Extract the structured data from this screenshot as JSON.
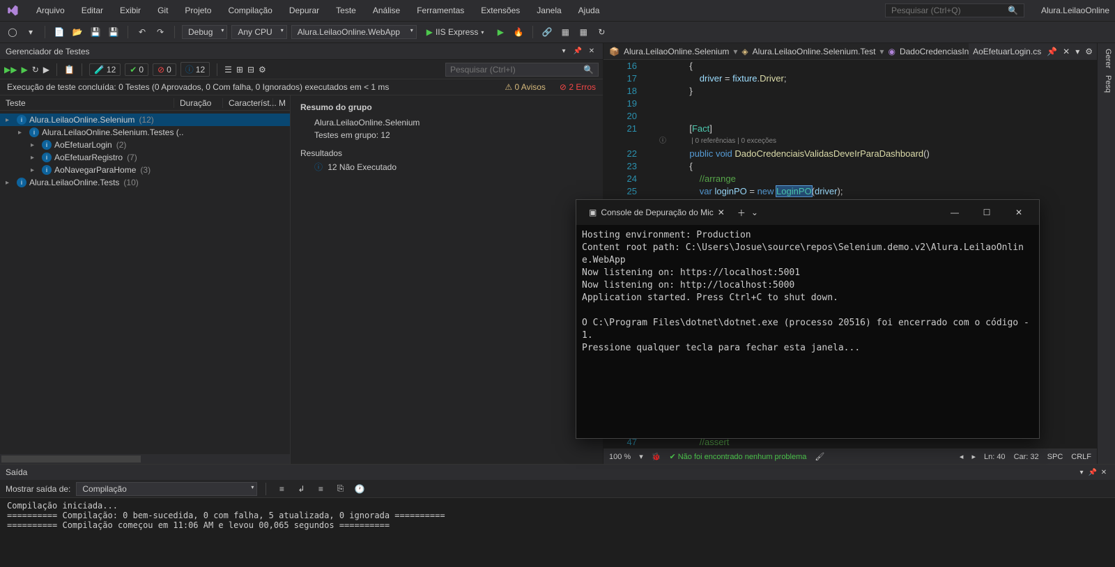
{
  "menubar": {
    "items": [
      "Arquivo",
      "Editar",
      "Exibir",
      "Git",
      "Projeto",
      "Compilação",
      "Depurar",
      "Teste",
      "Análise",
      "Ferramentas",
      "Extensões",
      "Janela",
      "Ajuda"
    ],
    "search_placeholder": "Pesquisar (Ctrl+Q)",
    "solution": "Alura.LeilaoOnline"
  },
  "toolbar": {
    "config": "Debug",
    "platform": "Any CPU",
    "startup": "Alura.LeilaoOnline.WebApp",
    "run_label": "IIS Express"
  },
  "test_explorer": {
    "title": "Gerenciador de Testes",
    "counters": {
      "flask": "12",
      "pass": "0",
      "fail": "0",
      "skip": "12"
    },
    "search_placeholder": "Pesquisar (Ctrl+I)",
    "status_line": "Execução de teste concluída: 0 Testes (0 Aprovados, 0 Com falha, 0 Ignorados) executados em < 1 ms",
    "warnings": "0 Avisos",
    "errors": "2 Erros",
    "columns": {
      "test": "Teste",
      "duration": "Duração",
      "traits": "Característ...",
      "m": "M"
    },
    "tree": [
      {
        "indent": 0,
        "caret": "▸",
        "label": "Alura.LeilaoOnline.Selenium",
        "count": "(12)",
        "selected": true
      },
      {
        "indent": 1,
        "caret": "▸",
        "label": "Alura.LeilaoOnline.Selenium.Testes (..",
        "count": ""
      },
      {
        "indent": 2,
        "caret": "▸",
        "label": "AoEfetuarLogin",
        "count": "(2)"
      },
      {
        "indent": 2,
        "caret": "▸",
        "label": "AoEfetuarRegistro",
        "count": "(7)"
      },
      {
        "indent": 2,
        "caret": "▸",
        "label": "AoNavegarParaHome",
        "count": "(3)"
      },
      {
        "indent": 0,
        "caret": "▸",
        "label": "Alura.LeilaoOnline.Tests",
        "count": "(10)"
      }
    ],
    "detail": {
      "heading": "Resumo do grupo",
      "group_name": "Alura.LeilaoOnline.Selenium",
      "tests_in_group": "Testes em grupo: 12",
      "results_heading": "Resultados",
      "results_line": "12 Não Executado"
    }
  },
  "editor": {
    "tabs": {
      "active": "AoEfetuarLogin.cs"
    },
    "breadcrumbs": [
      "Alura.LeilaoOnline.Selenium",
      "Alura.LeilaoOnline.Selenium.Test",
      "DadoCredenciasInvalidasDeveC"
    ],
    "lines": {
      "l17": "                driver = fixture.Driver;",
      "l18": "            }",
      "l19": "",
      "l20": "",
      "l21_a": "            [",
      "l21_b": "Fact",
      "l21_c": "]",
      "l21m": "             | 0 referências | 0 exceções",
      "l22": "            public void DadoCredenciaisValidasDeveIrParaDashboard()",
      "l23": "            {",
      "l24": "                //arrange",
      "l25_a": "                var loginPO = new ",
      "l25_b": "LoginPO",
      "l25_c": "(driver);",
      "l47": "                //assert"
    },
    "status": {
      "zoom": "100 %",
      "issues": "Não foi encontrado nenhum problema",
      "ln": "Ln: 40",
      "car": "Car: 32",
      "spc": "SPC",
      "crlf": "CRLF"
    }
  },
  "right_panel": {
    "tab1": "Gerer",
    "tab2": "Pesq"
  },
  "output": {
    "title": "Saída",
    "show_from_label": "Mostrar saída de:",
    "show_from_value": "Compilação",
    "content": "Compilação iniciada...\n========== Compilação: 0 bem-sucedida, 0 com falha, 5 atualizada, 0 ignorada ==========\n========== Compilação começou em 11:06 AM e levou 00,065 segundos =========="
  },
  "console": {
    "title": "Console de Depuração do Mic",
    "body": "Hosting environment: Production\nContent root path: C:\\Users\\Josue\\source\\repos\\Selenium.demo.v2\\Alura.LeilaoOnline.WebApp\nNow listening on: https://localhost:5001\nNow listening on: http://localhost:5000\nApplication started. Press Ctrl+C to shut down.\n\nO C:\\Program Files\\dotnet\\dotnet.exe (processo 20516) foi encerrado com o código -1.\nPressione qualquer tecla para fechar esta janela..."
  }
}
